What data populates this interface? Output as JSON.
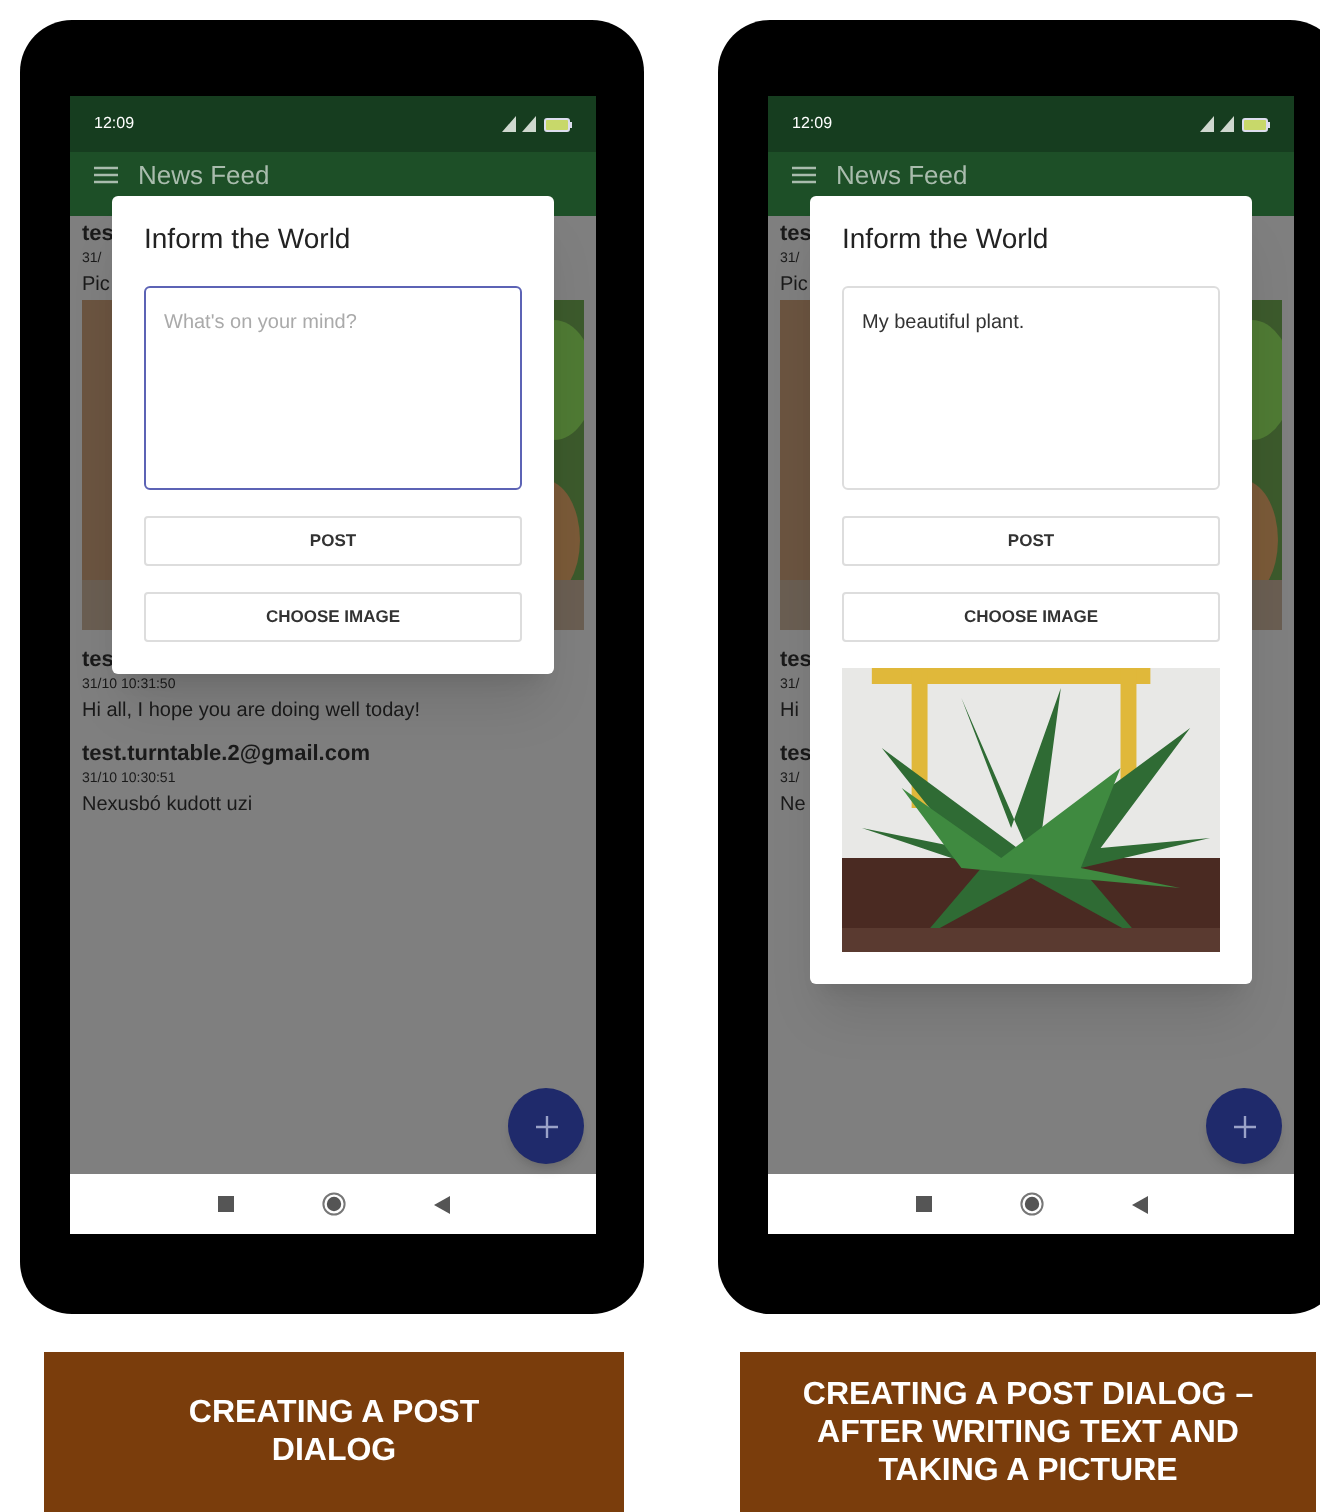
{
  "phones": [
    {
      "status_time": "12:09",
      "app_title": "News Feed",
      "feed": [
        {
          "author": "tes",
          "time": "31/",
          "text": "Pic",
          "picture": true
        },
        {
          "author": "tes",
          "time": "31/10 10:31:50",
          "text": "Hi all, I hope you are doing well today!",
          "picture": false
        },
        {
          "author": "test.turntable.2@gmail.com",
          "time": "31/10 10:30:51",
          "text": "Nexusbó kudott uzi",
          "picture": false
        }
      ],
      "dialog": {
        "title": "Inform the World",
        "field": {
          "placeholder": "What's on your mind?"
        },
        "focused": true,
        "buttons": [
          "POST",
          "CHOOSE IMAGE"
        ],
        "image": false
      },
      "caption": "CREATING A POST DIALOG"
    },
    {
      "status_time": "12:09",
      "app_title": "News Feed",
      "feed": [
        {
          "author": "tes",
          "time": "31/",
          "text": "Pic",
          "picture": true
        },
        {
          "author": "tes",
          "time": "31/",
          "text": "Hi",
          "picture": false
        },
        {
          "author": "tes",
          "time": "31/",
          "text": "Ne",
          "picture": false
        }
      ],
      "dialog": {
        "title": "Inform the World",
        "field": {
          "value": "My beautiful plant."
        },
        "focused": false,
        "buttons": [
          "POST",
          "CHOOSE IMAGE"
        ],
        "image": true
      },
      "caption": "CREATING A POST DIALOG – AFTER WRITING TEXT AND TAKING A PICTURE"
    }
  ]
}
